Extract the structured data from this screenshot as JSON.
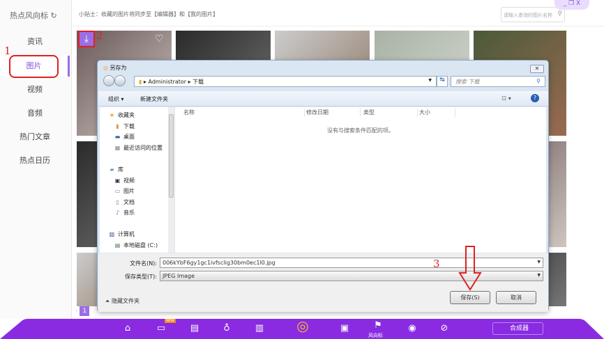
{
  "app": {
    "brand": "热点风向标",
    "refresh_icon": "refresh-icon"
  },
  "sidebar": {
    "items": [
      {
        "label": "资讯"
      },
      {
        "label": "图片"
      },
      {
        "label": "视频"
      },
      {
        "label": "音频"
      },
      {
        "label": "热门文章"
      },
      {
        "label": "热点日历"
      }
    ],
    "active": "图片"
  },
  "topbar": {
    "tip": "小贴士：收藏的图片将同步至【编辑器】和【我的图片】",
    "search_placeholder": "请输入查询的图片名称",
    "window_controls": "_ ❐ X"
  },
  "annotations": {
    "step1": "1",
    "step2": "2",
    "step3": "3"
  },
  "dialog": {
    "title": "另存为",
    "path": [
      "Administrator",
      "下载"
    ],
    "search_placeholder": "搜索 下载",
    "toolbar": {
      "organize": "组织 ▾",
      "new_folder": "新建文件夹"
    },
    "nav": {
      "favorites": "收藏夹",
      "fav_items": [
        "下载",
        "桌面",
        "最近访问的位置"
      ],
      "library": "库",
      "lib_items": [
        "视频",
        "图片",
        "文档",
        "音乐"
      ],
      "computer": "计算机",
      "drives": [
        "本地磁盘 (C:)"
      ]
    },
    "columns": [
      "名称",
      "修改日期",
      "类型",
      "大小"
    ],
    "empty_message": "没有与搜索条件匹配的项。",
    "filename_label": "文件名(N):",
    "filename": "006kYbF6gy1gc1ivfsclig30bm0ec1l0.jpg",
    "type_label": "保存类型(T):",
    "type": "JPEG Image",
    "save": "保存(S)",
    "cancel": "取消",
    "hide_folders": "隐藏文件夹"
  },
  "pager": {
    "current": "1"
  },
  "bottombar": {
    "new_badge": "NEW",
    "fxb_label": "风向标",
    "composer": "合成器",
    "accent": "#8a2be2"
  }
}
